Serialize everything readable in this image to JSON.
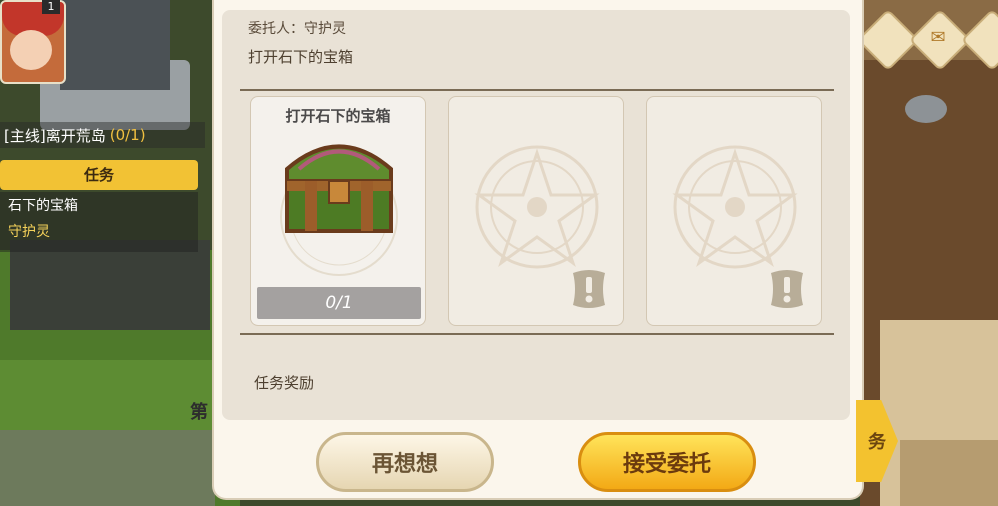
{
  "hud": {
    "level": "1",
    "quest_line": "[主线]离开荒岛",
    "quest_progress": "(0/1)",
    "task_tab": "任务",
    "task_items": [
      "石下的宝箱",
      "守护灵"
    ]
  },
  "dialog": {
    "client_label": "委托人：守护灵",
    "task_desc": "打开石下的宝箱",
    "cards": [
      {
        "title": "打开石下的宝箱",
        "count": "0/1",
        "state": "filled"
      },
      {
        "title": "",
        "count": "",
        "state": "locked"
      },
      {
        "title": "",
        "count": "",
        "state": "locked"
      }
    ],
    "reward_label": "任务奖励",
    "buttons": {
      "think": "再想想",
      "accept": "接受委托"
    }
  },
  "side": {
    "right_arrow_text": "务",
    "left_partial_text": "第"
  },
  "icons": [
    "treasure-chest-icon",
    "rune-emblem-icon",
    "scroll-exclamation-icon",
    "mail-icon"
  ]
}
